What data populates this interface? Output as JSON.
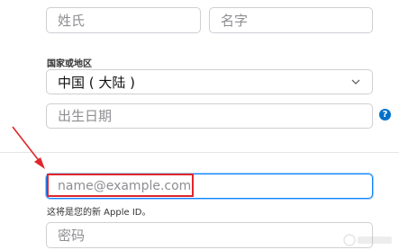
{
  "form": {
    "last_name_placeholder": "姓氏",
    "first_name_placeholder": "名字",
    "country_label": "国家或地区",
    "country_value": "中国 ( 大陆 )",
    "dob_placeholder": "出生日期",
    "help_glyph": "?",
    "email_placeholder": "name@example.com",
    "email_note": "这将是您的新 Apple ID。",
    "password_placeholder": "密码"
  },
  "icons": {
    "country_chevron": "chevron-down-icon",
    "help": "question-icon",
    "annotation_arrow": "arrow-icon"
  },
  "colors": {
    "focus_border": "#0a84ff",
    "help_bg": "#0070c9",
    "highlight": "#e0262b",
    "arrow": "#e0262b"
  }
}
